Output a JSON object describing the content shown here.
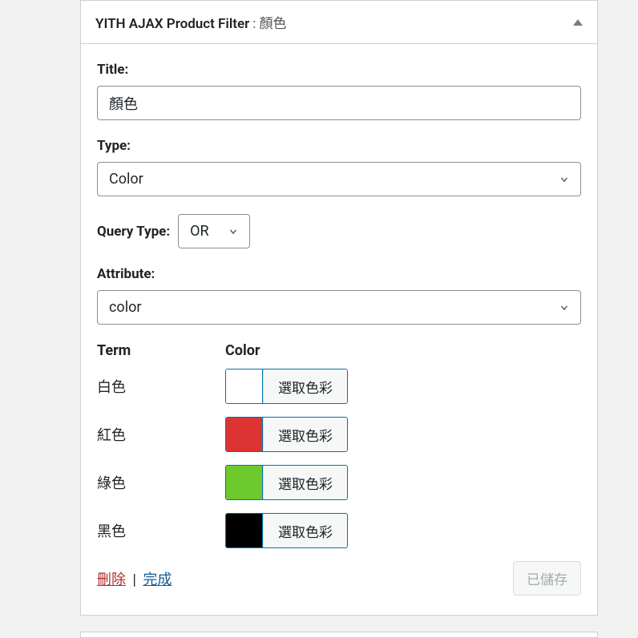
{
  "widget": {
    "title_prefix": "YITH AJAX Product Filter",
    "title_suffix": ": 顏色"
  },
  "fields": {
    "title_label": "Title:",
    "title_value": "顏色",
    "type_label": "Type:",
    "type_value": "Color",
    "query_type_label": "Query Type:",
    "query_type_value": "OR",
    "attribute_label": "Attribute:",
    "attribute_value": "color"
  },
  "term_table": {
    "head_term": "Term",
    "head_color": "Color",
    "rows": [
      {
        "name": "白色",
        "color": "#ffffff",
        "btn": "選取色彩"
      },
      {
        "name": "紅色",
        "color": "#dd3333",
        "btn": "選取色彩"
      },
      {
        "name": "綠色",
        "color": "#6ec92e",
        "btn": "選取色彩"
      },
      {
        "name": "黑色",
        "color": "#000000",
        "btn": "選取色彩"
      }
    ]
  },
  "actions": {
    "delete": "刪除",
    "sep": "|",
    "done": "完成",
    "saved": "已儲存"
  }
}
